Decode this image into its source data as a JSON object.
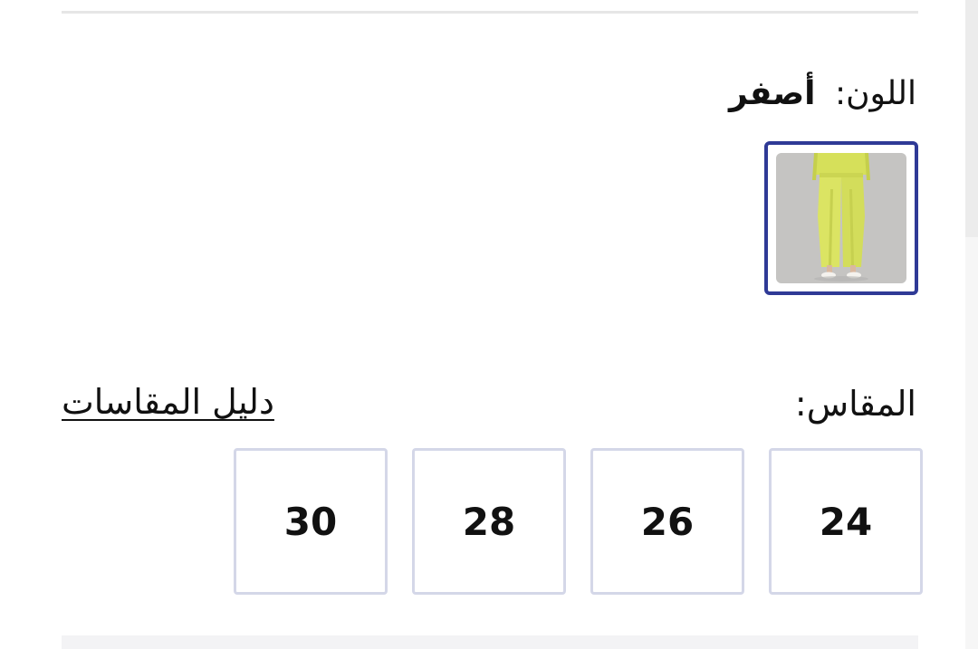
{
  "color": {
    "label": "اللون:",
    "value": "أصفر",
    "swatch_image": "yellow-wide-leg-trousers",
    "selected_border_color": "#2f3a96"
  },
  "size": {
    "label": "المقاس:",
    "guide_link": "دليل المقاسات",
    "options": [
      "24",
      "26",
      "28",
      "30"
    ],
    "option_border_color": "#d4d7e8"
  }
}
